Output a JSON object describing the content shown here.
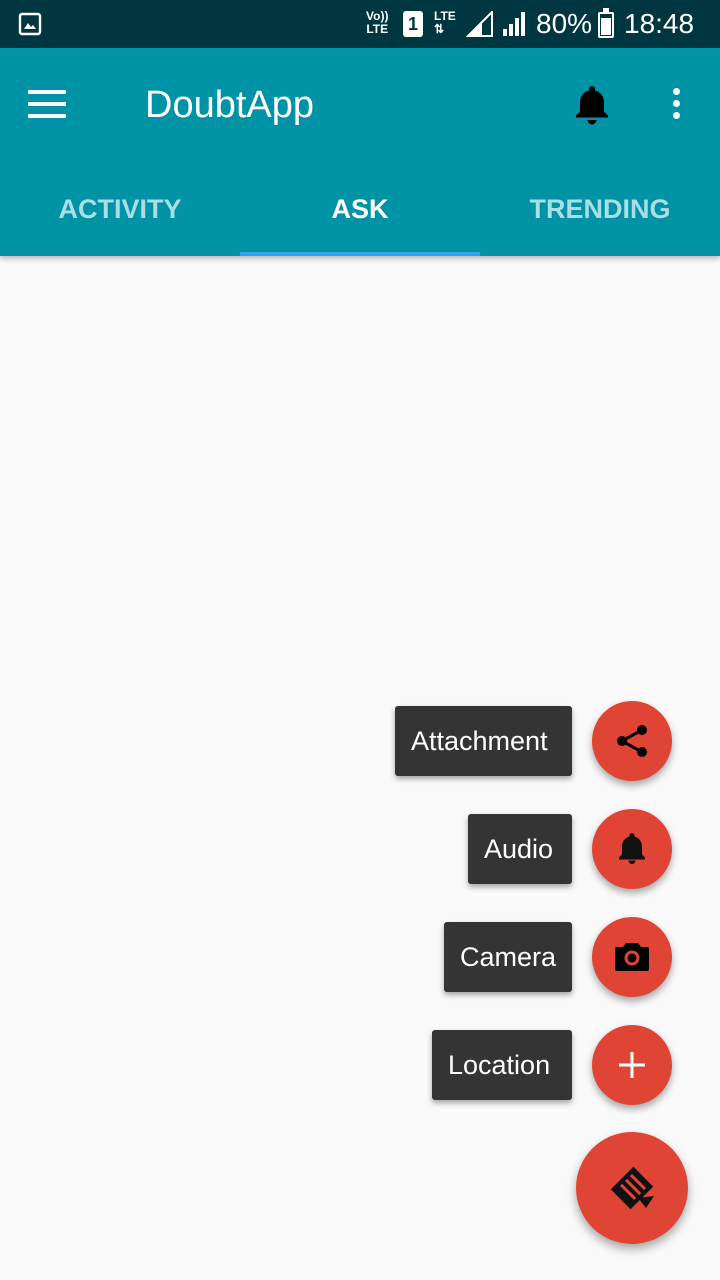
{
  "status_bar": {
    "volte_line1": "Vo))",
    "volte_line2": "LTE",
    "sim_slot": "1",
    "lte_label": "LTE",
    "battery": "80%",
    "time": "18:48"
  },
  "app_bar": {
    "title": "DoubtApp",
    "color": "#0093a6"
  },
  "tabs": [
    {
      "label": "ACTIVITY",
      "active": false
    },
    {
      "label": "ASK",
      "active": true
    },
    {
      "label": "TRENDING",
      "active": false
    }
  ],
  "fab_menu": {
    "accent": "#e04434",
    "items": [
      {
        "label": "Attachment",
        "icon": "share-icon"
      },
      {
        "label": "Audio",
        "icon": "bell-icon"
      },
      {
        "label": "Camera",
        "icon": "camera-icon"
      },
      {
        "label": "Location",
        "icon": "plus-icon"
      }
    ],
    "main_icon": "edit-icon"
  }
}
